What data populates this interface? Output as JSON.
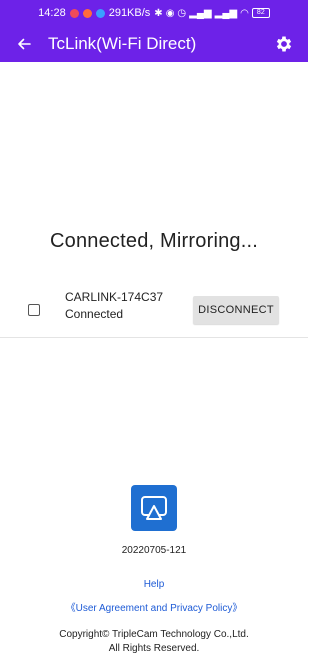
{
  "status_bar": {
    "time": "14:28",
    "speed": "291KB/s",
    "battery": "82"
  },
  "app_bar": {
    "title": "TcLink(Wi-Fi Direct)",
    "back_icon": "arrow-left-icon",
    "settings_icon": "gear-icon"
  },
  "main": {
    "headline": "Connected, Mirroring...",
    "device": {
      "name": "CARLINK-174C37",
      "status": "Connected",
      "checked": false,
      "disconnect_label": "DISCONNECT"
    }
  },
  "footer": {
    "logo_icon": "screen-mirror-icon",
    "version": "20220705-121",
    "help_label": "Help",
    "policy_label": "《User Agreement and Privacy Policy》",
    "copyright_line1": "Copyright© TripleCam Technology Co.,Ltd.",
    "copyright_line2": "All Rights Reserved."
  },
  "colors": {
    "primary": "#6d22e8",
    "link": "#1e5bd6",
    "logo_bg": "#1f6fd1"
  }
}
